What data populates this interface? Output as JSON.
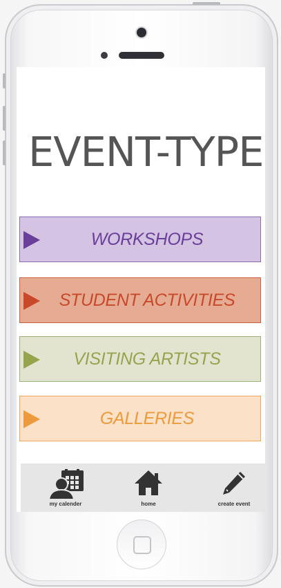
{
  "screen": {
    "title": "EVENT-TYPE"
  },
  "event_types": [
    {
      "label": "WORKSHOPS",
      "bg": "#d4c3e2",
      "border": "#8c6bb0",
      "accent": "#6a3f9a",
      "text": "#6a3f9a"
    },
    {
      "label": "STUDENT ACTIVITIES",
      "bg": "#e6ab93",
      "border": "#c8603e",
      "accent": "#c8492a",
      "text": "#c8492a"
    },
    {
      "label": "VISITING ARTISTS",
      "bg": "#e3e4cf",
      "border": "#9db07a",
      "accent": "#96a44e",
      "text": "#96a44e"
    },
    {
      "label": "GALLERIES",
      "bg": "#fae1c8",
      "border": "#efa75d",
      "accent": "#ed9a3c",
      "text": "#ed9a3c"
    }
  ],
  "navbar": {
    "items": [
      {
        "label": "my calender",
        "icon": "calendar-person-icon"
      },
      {
        "label": "home",
        "icon": "home-icon"
      },
      {
        "label": "create event",
        "icon": "pencil-icon"
      }
    ]
  }
}
